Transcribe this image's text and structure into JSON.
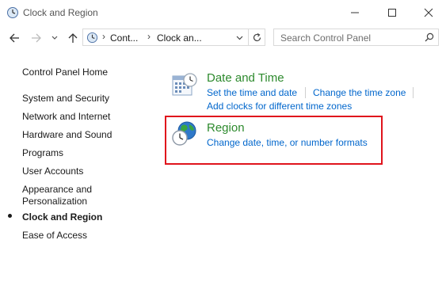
{
  "window": {
    "title": "Clock and Region"
  },
  "address_bar": {
    "crumbs": [
      "Cont...",
      "Clock an..."
    ],
    "search_placeholder": "Search Control Panel"
  },
  "sidebar": {
    "home": "Control Panel Home",
    "items": [
      {
        "label": "System and Security"
      },
      {
        "label": "Network and Internet"
      },
      {
        "label": "Hardware and Sound"
      },
      {
        "label": "Programs"
      },
      {
        "label": "User Accounts"
      },
      {
        "label": "Appearance and"
      },
      {
        "label": "Personalization"
      },
      {
        "label": "Clock and Region",
        "active": true
      },
      {
        "label": "Ease of Access"
      }
    ]
  },
  "categories": [
    {
      "title": "Date and Time",
      "icon": "calendar-clock-icon",
      "tasks": [
        "Set the time and date",
        "Change the time zone",
        "Add clocks for different time zones"
      ]
    },
    {
      "title": "Region",
      "icon": "globe-clock-icon",
      "tasks": [
        "Change date, time, or number formats"
      ]
    }
  ],
  "colors": {
    "category_title": "#2d8a2d",
    "task_link": "#0066cc",
    "highlight": "#e0141c"
  }
}
